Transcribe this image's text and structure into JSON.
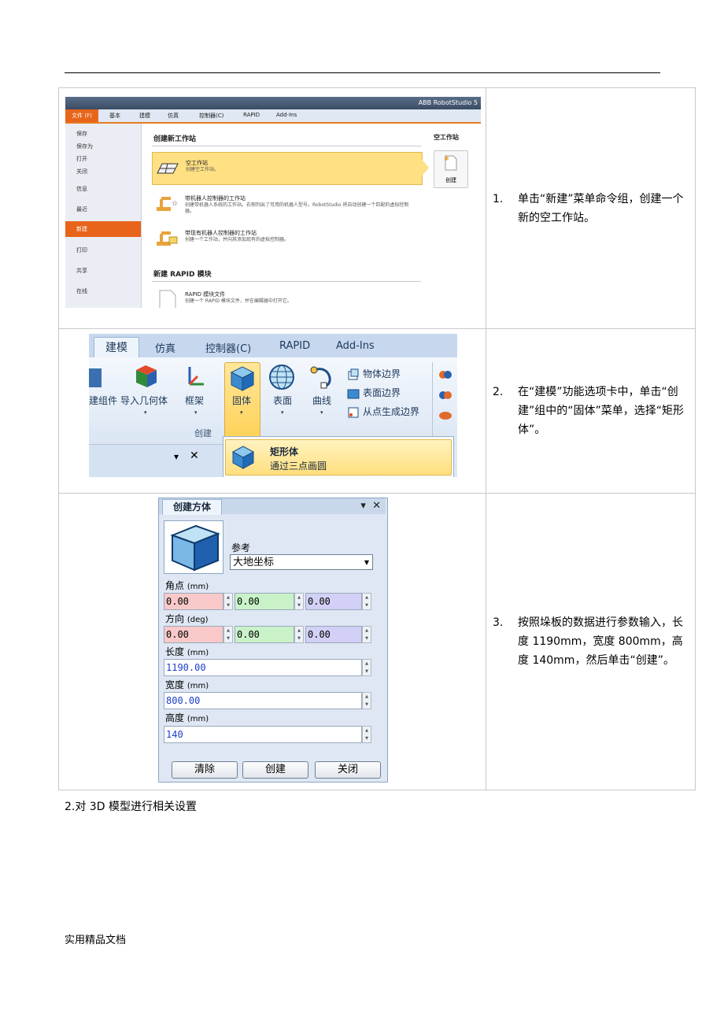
{
  "rows": [
    {
      "num": "1.",
      "text": "单击“新建”菜单命令组，创建一个新的空工作站。"
    },
    {
      "num": "2.",
      "text": "在“建模”功能选项卡中，单击“创建”组中的“固体”菜单，选择“矩形体”。"
    },
    {
      "num": "3.",
      "text": "按照垛板的数据进行参数输入，长度 1190mm，宽度 800mm，高度 140mm，然后单击“创建”。"
    }
  ],
  "after_text": "2.对 3D 模型进行相关设置",
  "footer": "实用精品文档",
  "screen1": {
    "app_title": "ABB RobotStudio 5",
    "tabs": {
      "file": "文件 (F)",
      "basic": "基本",
      "model": "建模",
      "sim": "仿真",
      "ctrl": "控制器(C)",
      "rapid": "RAPID",
      "addins": "Add-Ins"
    },
    "side": {
      "save": "保存",
      "saveas": "保存为",
      "open": "打开",
      "close": "关闭",
      "info": "信息",
      "recent": "最近",
      "new": "新建",
      "print": "打印",
      "share": "共享",
      "online": "在线"
    },
    "heading_station": "创建新工作站",
    "heading_rapid": "新建 RAPID 模块",
    "items": [
      {
        "title": "空工作站",
        "sub": "创建空工作站。"
      },
      {
        "title": "带机器人控制器的工作站",
        "sub": "创建带机器人系统的工作站。右侧列出了可用的机器人型号。RobotStudio 将自动创建一个匹配的虚拟控制器。"
      },
      {
        "title": "带现有机器人控制器的工作站",
        "sub": "创建一个工作站，并向其添加现有的虚拟控制器。"
      },
      {
        "title": "RAPID 模块文件",
        "sub": "创建一个 RAPID 模块文件，并在编辑器中打开它。"
      }
    ],
    "right_heading": "空工作站",
    "create_label": "创建"
  },
  "screen2": {
    "tabs": {
      "model": "建模",
      "sim": "仿真",
      "ctrl": "控制器(C)",
      "rapid": "RAPID",
      "addins": "Add-Ins"
    },
    "buttons": {
      "component": "建组件",
      "import": "导入几何体",
      "frame": "框架",
      "solid": "固体",
      "surface": "表面",
      "curve": "曲线"
    },
    "small": {
      "body_edge": "物体边界",
      "surf_edge": "表面边界",
      "pts_edge": "从点生成边界"
    },
    "group": "创建",
    "menu_title": "矩形体",
    "menu_sub": "通过三点画圆"
  },
  "screen3": {
    "title": "创建方体",
    "ref_label": "参考",
    "ref_value": "大地坐标",
    "corner_label": "角点",
    "unit_mm": "(mm)",
    "unit_deg": "(deg)",
    "corner": [
      "0.00",
      "0.00",
      "0.00"
    ],
    "dir_label": "方向",
    "dir": [
      "0.00",
      "0.00",
      "0.00"
    ],
    "length_label": "长度",
    "length": "1190.00",
    "width_label": "宽度",
    "width": "800.00",
    "height_label": "高度",
    "height": "140",
    "buttons": {
      "clear": "清除",
      "create": "创建",
      "close": "关闭"
    }
  }
}
